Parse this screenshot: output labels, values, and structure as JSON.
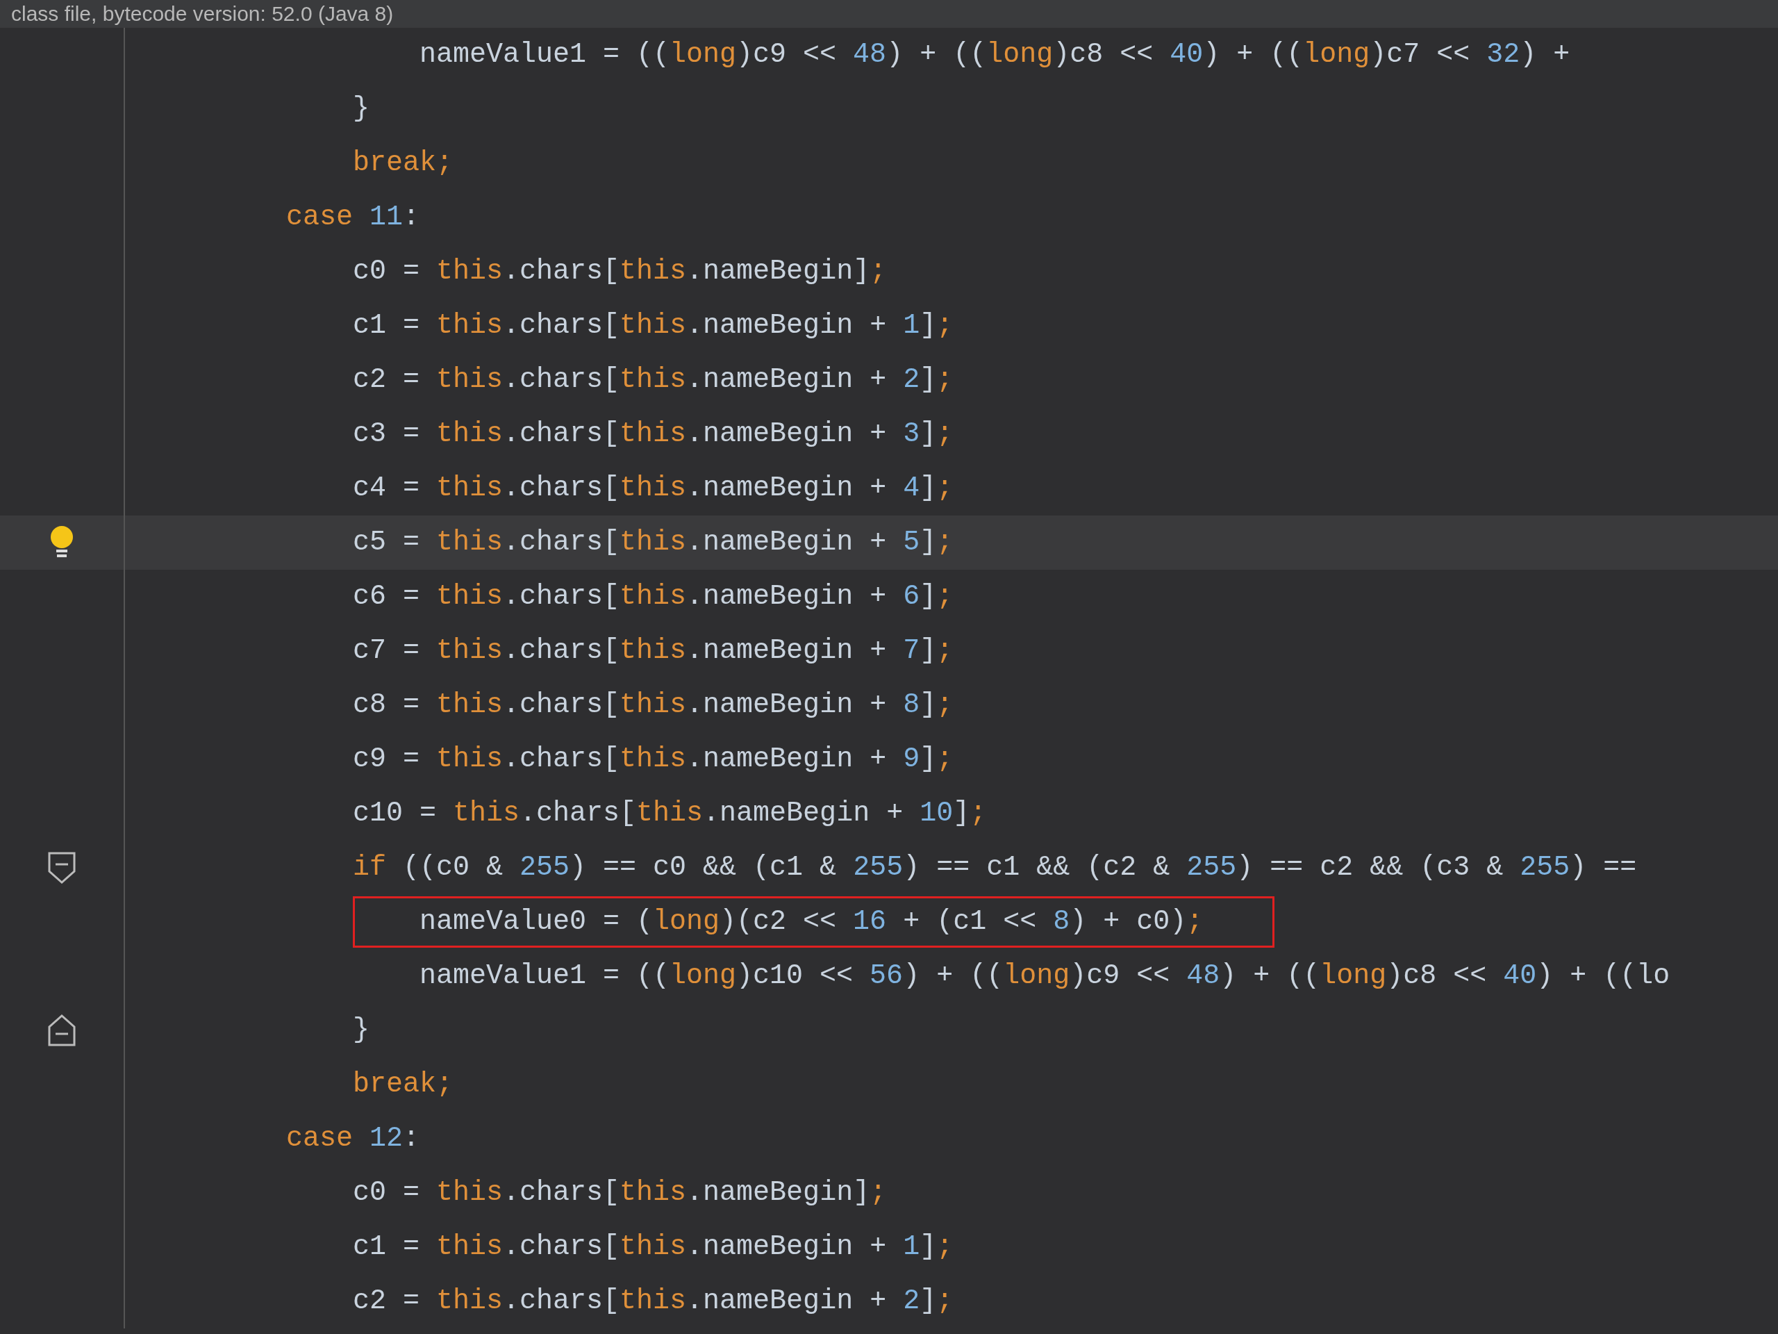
{
  "header": {
    "text": "class file, bytecode version: 52.0 (Java 8)"
  },
  "lines": [
    {
      "kind": "nested",
      "current": false,
      "boxed": false,
      "tokens": [
        {
          "t": "nameValue1 = ((",
          "kind": "plain"
        },
        {
          "t": "long",
          "kind": "keyword"
        },
        {
          "t": ")c9 << ",
          "kind": "plain"
        },
        {
          "t": "48",
          "kind": "number"
        },
        {
          "t": ") + ((",
          "kind": "plain"
        },
        {
          "t": "long",
          "kind": "keyword"
        },
        {
          "t": ")c8 << ",
          "kind": "plain"
        },
        {
          "t": "40",
          "kind": "number"
        },
        {
          "t": ") + ((",
          "kind": "plain"
        },
        {
          "t": "long",
          "kind": "keyword"
        },
        {
          "t": ")c7 << ",
          "kind": "plain"
        },
        {
          "t": "32",
          "kind": "number"
        },
        {
          "t": ") +",
          "kind": "plain"
        }
      ]
    },
    {
      "kind": "body",
      "current": false,
      "boxed": false,
      "tokens": [
        {
          "t": "}",
          "kind": "plain"
        }
      ]
    },
    {
      "kind": "body",
      "current": false,
      "boxed": false,
      "tokens": [
        {
          "t": "break",
          "kind": "keyword"
        },
        {
          "t": ";",
          "kind": "keyword"
        }
      ]
    },
    {
      "kind": "case",
      "current": false,
      "boxed": false,
      "tokens": [
        {
          "t": "case ",
          "kind": "keyword"
        },
        {
          "t": "11",
          "kind": "number"
        },
        {
          "t": ":",
          "kind": "plain"
        }
      ]
    },
    {
      "kind": "body",
      "current": false,
      "boxed": false,
      "tokens": [
        {
          "t": "c0 = ",
          "kind": "plain"
        },
        {
          "t": "this",
          "kind": "keyword"
        },
        {
          "t": ".chars[",
          "kind": "plain"
        },
        {
          "t": "this",
          "kind": "keyword"
        },
        {
          "t": ".nameBegin]",
          "kind": "plain"
        },
        {
          "t": ";",
          "kind": "keyword"
        }
      ]
    },
    {
      "kind": "body",
      "current": false,
      "boxed": false,
      "tokens": [
        {
          "t": "c1 = ",
          "kind": "plain"
        },
        {
          "t": "this",
          "kind": "keyword"
        },
        {
          "t": ".chars[",
          "kind": "plain"
        },
        {
          "t": "this",
          "kind": "keyword"
        },
        {
          "t": ".nameBegin + ",
          "kind": "plain"
        },
        {
          "t": "1",
          "kind": "number"
        },
        {
          "t": "]",
          "kind": "plain"
        },
        {
          "t": ";",
          "kind": "keyword"
        }
      ]
    },
    {
      "kind": "body",
      "current": false,
      "boxed": false,
      "tokens": [
        {
          "t": "c2 = ",
          "kind": "plain"
        },
        {
          "t": "this",
          "kind": "keyword"
        },
        {
          "t": ".chars[",
          "kind": "plain"
        },
        {
          "t": "this",
          "kind": "keyword"
        },
        {
          "t": ".nameBegin + ",
          "kind": "plain"
        },
        {
          "t": "2",
          "kind": "number"
        },
        {
          "t": "]",
          "kind": "plain"
        },
        {
          "t": ";",
          "kind": "keyword"
        }
      ]
    },
    {
      "kind": "body",
      "current": false,
      "boxed": false,
      "tokens": [
        {
          "t": "c3 = ",
          "kind": "plain"
        },
        {
          "t": "this",
          "kind": "keyword"
        },
        {
          "t": ".chars[",
          "kind": "plain"
        },
        {
          "t": "this",
          "kind": "keyword"
        },
        {
          "t": ".nameBegin + ",
          "kind": "plain"
        },
        {
          "t": "3",
          "kind": "number"
        },
        {
          "t": "]",
          "kind": "plain"
        },
        {
          "t": ";",
          "kind": "keyword"
        }
      ]
    },
    {
      "kind": "body",
      "current": false,
      "boxed": false,
      "tokens": [
        {
          "t": "c4 = ",
          "kind": "plain"
        },
        {
          "t": "this",
          "kind": "keyword"
        },
        {
          "t": ".chars[",
          "kind": "plain"
        },
        {
          "t": "this",
          "kind": "keyword"
        },
        {
          "t": ".nameBegin + ",
          "kind": "plain"
        },
        {
          "t": "4",
          "kind": "number"
        },
        {
          "t": "]",
          "kind": "plain"
        },
        {
          "t": ";",
          "kind": "keyword"
        }
      ]
    },
    {
      "kind": "body",
      "current": true,
      "boxed": false,
      "marker": {
        "kind": "bulb"
      },
      "tokens": [
        {
          "t": "c5 = ",
          "kind": "plain"
        },
        {
          "t": "this",
          "kind": "keyword"
        },
        {
          "t": ".chars[",
          "kind": "plain"
        },
        {
          "t": "this",
          "kind": "keyword"
        },
        {
          "t": ".nameBegin + ",
          "kind": "plain"
        },
        {
          "t": "5",
          "kind": "number"
        },
        {
          "t": "]",
          "kind": "plain"
        },
        {
          "t": ";",
          "kind": "keyword"
        }
      ]
    },
    {
      "kind": "body",
      "current": false,
      "boxed": false,
      "tokens": [
        {
          "t": "c6 = ",
          "kind": "plain"
        },
        {
          "t": "this",
          "kind": "keyword"
        },
        {
          "t": ".chars[",
          "kind": "plain"
        },
        {
          "t": "this",
          "kind": "keyword"
        },
        {
          "t": ".nameBegin + ",
          "kind": "plain"
        },
        {
          "t": "6",
          "kind": "number"
        },
        {
          "t": "]",
          "kind": "plain"
        },
        {
          "t": ";",
          "kind": "keyword"
        }
      ]
    },
    {
      "kind": "body",
      "current": false,
      "boxed": false,
      "tokens": [
        {
          "t": "c7 = ",
          "kind": "plain"
        },
        {
          "t": "this",
          "kind": "keyword"
        },
        {
          "t": ".chars[",
          "kind": "plain"
        },
        {
          "t": "this",
          "kind": "keyword"
        },
        {
          "t": ".nameBegin + ",
          "kind": "plain"
        },
        {
          "t": "7",
          "kind": "number"
        },
        {
          "t": "]",
          "kind": "plain"
        },
        {
          "t": ";",
          "kind": "keyword"
        }
      ]
    },
    {
      "kind": "body",
      "current": false,
      "boxed": false,
      "tokens": [
        {
          "t": "c8 = ",
          "kind": "plain"
        },
        {
          "t": "this",
          "kind": "keyword"
        },
        {
          "t": ".chars[",
          "kind": "plain"
        },
        {
          "t": "this",
          "kind": "keyword"
        },
        {
          "t": ".nameBegin + ",
          "kind": "plain"
        },
        {
          "t": "8",
          "kind": "number"
        },
        {
          "t": "]",
          "kind": "plain"
        },
        {
          "t": ";",
          "kind": "keyword"
        }
      ]
    },
    {
      "kind": "body",
      "current": false,
      "boxed": false,
      "tokens": [
        {
          "t": "c9 = ",
          "kind": "plain"
        },
        {
          "t": "this",
          "kind": "keyword"
        },
        {
          "t": ".chars[",
          "kind": "plain"
        },
        {
          "t": "this",
          "kind": "keyword"
        },
        {
          "t": ".nameBegin + ",
          "kind": "plain"
        },
        {
          "t": "9",
          "kind": "number"
        },
        {
          "t": "]",
          "kind": "plain"
        },
        {
          "t": ";",
          "kind": "keyword"
        }
      ]
    },
    {
      "kind": "body",
      "current": false,
      "boxed": false,
      "tokens": [
        {
          "t": "c10 = ",
          "kind": "plain"
        },
        {
          "t": "this",
          "kind": "keyword"
        },
        {
          "t": ".chars[",
          "kind": "plain"
        },
        {
          "t": "this",
          "kind": "keyword"
        },
        {
          "t": ".nameBegin + ",
          "kind": "plain"
        },
        {
          "t": "10",
          "kind": "number"
        },
        {
          "t": "]",
          "kind": "plain"
        },
        {
          "t": ";",
          "kind": "keyword"
        }
      ]
    },
    {
      "kind": "body",
      "current": false,
      "boxed": false,
      "marker": {
        "kind": "fold-start"
      },
      "tokens": [
        {
          "t": "if ",
          "kind": "keyword"
        },
        {
          "t": "((c0 & ",
          "kind": "plain"
        },
        {
          "t": "255",
          "kind": "number"
        },
        {
          "t": ") == c0 && (c1 & ",
          "kind": "plain"
        },
        {
          "t": "255",
          "kind": "number"
        },
        {
          "t": ") == c1 && (c2 & ",
          "kind": "plain"
        },
        {
          "t": "255",
          "kind": "number"
        },
        {
          "t": ") == c2 && (c3 & ",
          "kind": "plain"
        },
        {
          "t": "255",
          "kind": "number"
        },
        {
          "t": ") ==",
          "kind": "plain"
        }
      ]
    },
    {
      "kind": "nested",
      "current": false,
      "boxed": true,
      "tokens": [
        {
          "t": "nameValue0 = (",
          "kind": "plain"
        },
        {
          "t": "long",
          "kind": "keyword"
        },
        {
          "t": ")(c2 << ",
          "kind": "plain"
        },
        {
          "t": "16",
          "kind": "number"
        },
        {
          "t": " + (c1 << ",
          "kind": "plain"
        },
        {
          "t": "8",
          "kind": "number"
        },
        {
          "t": ") + c0)",
          "kind": "plain"
        },
        {
          "t": ";",
          "kind": "keyword"
        }
      ]
    },
    {
      "kind": "nested",
      "current": false,
      "boxed": false,
      "tokens": [
        {
          "t": "nameValue1 = ((",
          "kind": "plain"
        },
        {
          "t": "long",
          "kind": "keyword"
        },
        {
          "t": ")c10 << ",
          "kind": "plain"
        },
        {
          "t": "56",
          "kind": "number"
        },
        {
          "t": ") + ((",
          "kind": "plain"
        },
        {
          "t": "long",
          "kind": "keyword"
        },
        {
          "t": ")c9 << ",
          "kind": "plain"
        },
        {
          "t": "48",
          "kind": "number"
        },
        {
          "t": ") + ((",
          "kind": "plain"
        },
        {
          "t": "long",
          "kind": "keyword"
        },
        {
          "t": ")c8 << ",
          "kind": "plain"
        },
        {
          "t": "40",
          "kind": "number"
        },
        {
          "t": ") + ((lo",
          "kind": "plain"
        }
      ]
    },
    {
      "kind": "body",
      "current": false,
      "boxed": false,
      "marker": {
        "kind": "fold-end"
      },
      "tokens": [
        {
          "t": "}",
          "kind": "plain"
        }
      ]
    },
    {
      "kind": "body",
      "current": false,
      "boxed": false,
      "tokens": [
        {
          "t": "break",
          "kind": "keyword"
        },
        {
          "t": ";",
          "kind": "keyword"
        }
      ]
    },
    {
      "kind": "case",
      "current": false,
      "boxed": false,
      "tokens": [
        {
          "t": "case ",
          "kind": "keyword"
        },
        {
          "t": "12",
          "kind": "number"
        },
        {
          "t": ":",
          "kind": "plain"
        }
      ]
    },
    {
      "kind": "body",
      "current": false,
      "boxed": false,
      "tokens": [
        {
          "t": "c0 = ",
          "kind": "plain"
        },
        {
          "t": "this",
          "kind": "keyword"
        },
        {
          "t": ".chars[",
          "kind": "plain"
        },
        {
          "t": "this",
          "kind": "keyword"
        },
        {
          "t": ".nameBegin]",
          "kind": "plain"
        },
        {
          "t": ";",
          "kind": "keyword"
        }
      ]
    },
    {
      "kind": "body",
      "current": false,
      "boxed": false,
      "tokens": [
        {
          "t": "c1 = ",
          "kind": "plain"
        },
        {
          "t": "this",
          "kind": "keyword"
        },
        {
          "t": ".chars[",
          "kind": "plain"
        },
        {
          "t": "this",
          "kind": "keyword"
        },
        {
          "t": ".nameBegin + ",
          "kind": "plain"
        },
        {
          "t": "1",
          "kind": "number"
        },
        {
          "t": "]",
          "kind": "plain"
        },
        {
          "t": ";",
          "kind": "keyword"
        }
      ]
    },
    {
      "kind": "body",
      "current": false,
      "boxed": false,
      "tokens": [
        {
          "t": "c2 = ",
          "kind": "plain"
        },
        {
          "t": "this",
          "kind": "keyword"
        },
        {
          "t": ".chars[",
          "kind": "plain"
        },
        {
          "t": "this",
          "kind": "keyword"
        },
        {
          "t": ".nameBegin + ",
          "kind": "plain"
        },
        {
          "t": "2",
          "kind": "number"
        },
        {
          "t": "]",
          "kind": "plain"
        },
        {
          "t": ";",
          "kind": "keyword"
        }
      ]
    }
  ]
}
